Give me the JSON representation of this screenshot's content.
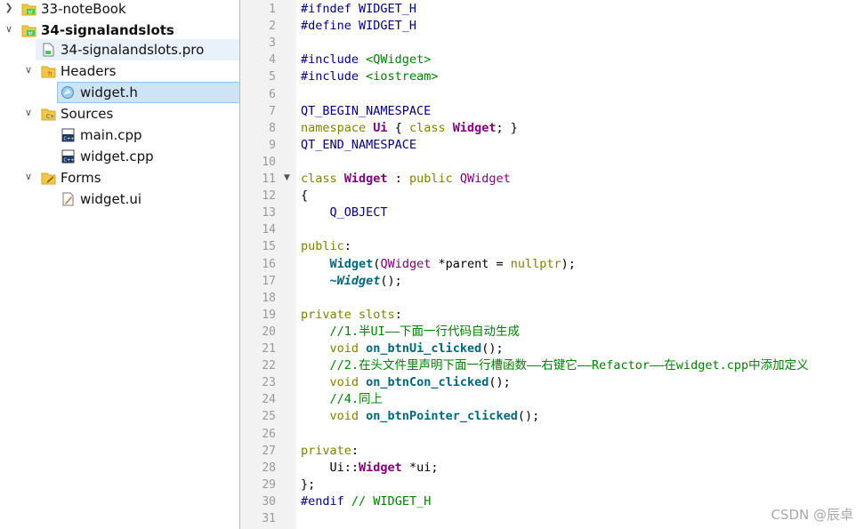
{
  "tree": {
    "items": [
      {
        "label": "33-noteBook",
        "bold": false
      },
      {
        "label": "34-signalandslots",
        "bold": true
      },
      {
        "label": "34-signalandslots.pro"
      },
      {
        "label": "Headers"
      },
      {
        "label": "widget.h"
      },
      {
        "label": "Sources"
      },
      {
        "label": "main.cpp"
      },
      {
        "label": "widget.cpp"
      },
      {
        "label": "Forms"
      },
      {
        "label": "widget.ui"
      }
    ]
  },
  "editor": {
    "file": "widget.h",
    "line_numbers": [
      "1",
      "2",
      "3",
      "4",
      "5",
      "6",
      "7",
      "8",
      "9",
      "10",
      "11",
      "12",
      "13",
      "14",
      "15",
      "16",
      "17",
      "18",
      "19",
      "20",
      "21",
      "22",
      "23",
      "24",
      "25",
      "26",
      "27",
      "28",
      "29",
      "30",
      "31"
    ],
    "lines": [
      "#ifndef WIDGET_H",
      "#define WIDGET_H",
      "",
      "#include <QWidget>",
      "#include <iostream>",
      "",
      "QT_BEGIN_NAMESPACE",
      "namespace Ui { class Widget; }",
      "QT_END_NAMESPACE",
      "",
      "class Widget : public QWidget",
      "{",
      "    Q_OBJECT",
      "",
      "public:",
      "    Widget(QWidget *parent = nullptr);",
      "    ~Widget();",
      "",
      "private slots:",
      "    //1.半UI——下面一行代码自动生成",
      "    void on_btnUi_clicked();",
      "    //2.在头文件里声明下面一行槽函数——右键它——Refactor——在widget.cpp中添加定义",
      "    void on_btnCon_clicked();",
      "    //4.同上",
      "    void on_btnPointer_clicked();",
      "",
      "private:",
      "    Ui::Widget *ui;",
      "};",
      "#endif // WIDGET_H",
      ""
    ]
  },
  "watermark": "CSDN @辰卓",
  "colors": {
    "selection": "#cde4f7",
    "keyword": "#808000",
    "type": "#800080",
    "function": "#00677c",
    "comment": "#008000",
    "preprocessor": "#000080"
  },
  "icons": [
    "chevron-right-icon",
    "chevron-down-icon",
    "qt-project-icon",
    "pro-file-icon",
    "headers-folder-icon",
    "header-file-icon",
    "sources-folder-icon",
    "cpp-file-icon",
    "forms-folder-icon",
    "ui-file-icon",
    "fold-arrow-icon"
  ]
}
